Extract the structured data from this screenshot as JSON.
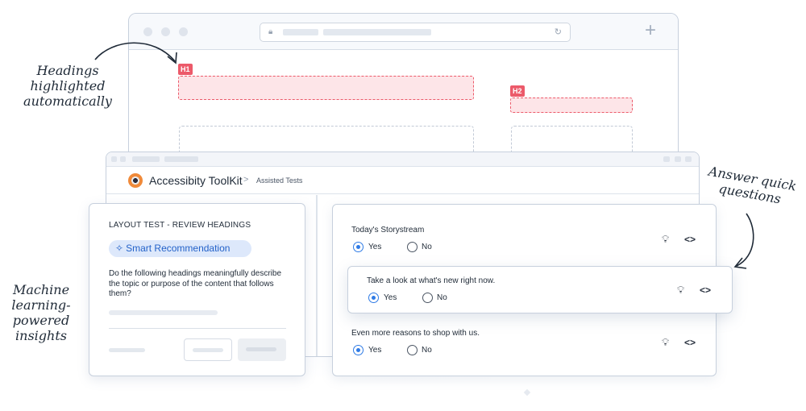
{
  "annotations": {
    "headings": [
      "Headings",
      "highlighted",
      "automatically"
    ],
    "machine": [
      "Machine",
      "learning-",
      "powered",
      "insights"
    ],
    "answer": [
      "Answer quick",
      "questions"
    ]
  },
  "browser": {
    "badges": {
      "h1": "H1",
      "h2": "H2"
    }
  },
  "toolkit": {
    "title": "Accessibity ToolKit",
    "breadcrumb_separator": ">",
    "breadcrumb": "Assisted Tests"
  },
  "review_card": {
    "title": "LAYOUT TEST - REVIEW HEADINGS",
    "recommendation": "Smart Recommendation",
    "question": "Do the following headings meaningfully describe the topic or purpose of the content that follows them?"
  },
  "questions": [
    {
      "text": "Today's Storystream",
      "yes": "Yes",
      "no": "No",
      "selected": "Yes"
    },
    {
      "text": "Take a look at what's new right now.",
      "yes": "Yes",
      "no": "No",
      "selected": "Yes"
    },
    {
      "text": "Even more reasons to shop with us.",
      "yes": "Yes",
      "no": "No",
      "selected": "Yes"
    }
  ],
  "icons": {
    "hint": "lightbulb-icon",
    "code": "code-icon",
    "brand": "eye-logo-icon",
    "sparkle": "sparkle-icon"
  },
  "colors": {
    "accent": "#2f7be5",
    "heading_highlight": "#ec5a6a",
    "recommendation_bg": "#dde8fb"
  }
}
